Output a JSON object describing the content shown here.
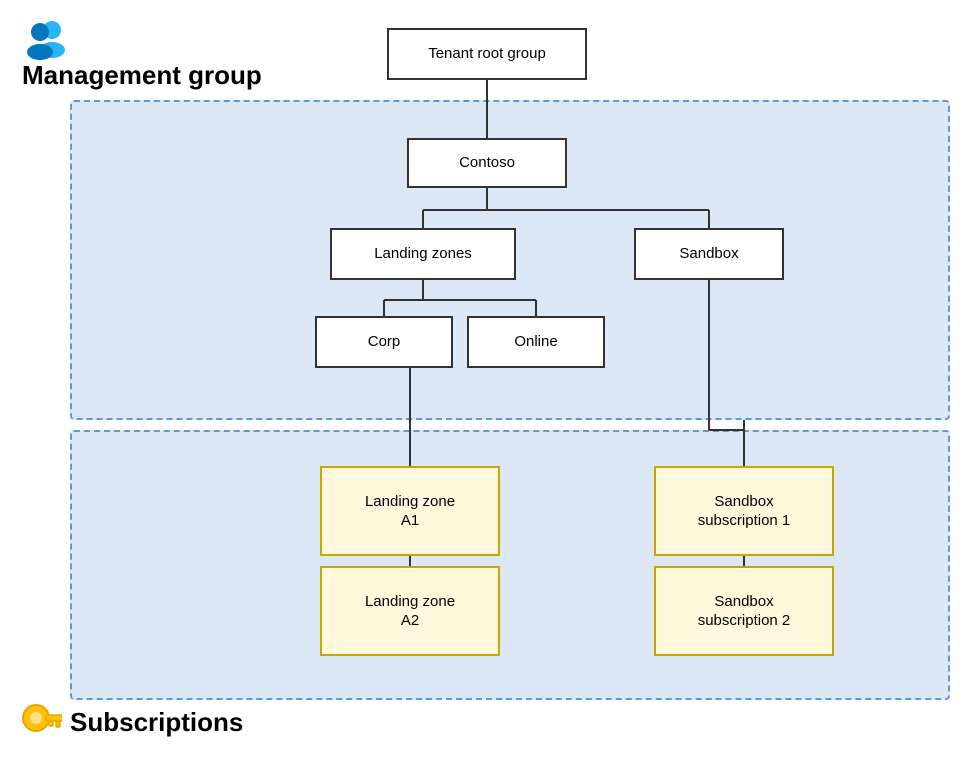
{
  "header": {
    "mgmt_label": "Management group",
    "sub_label": "Subscriptions"
  },
  "nodes": {
    "tenant_root": "Tenant root group",
    "contoso": "Contoso",
    "landing_zones": "Landing zones",
    "sandbox": "Sandbox",
    "corp": "Corp",
    "online": "Online",
    "lz_a1": "Landing zone\nA1",
    "lz_a2": "Landing zone\nA2",
    "sandbox_sub1": "Sandbox\nsubscription 1",
    "sandbox_sub2": "Sandbox\nsubscription 2"
  }
}
